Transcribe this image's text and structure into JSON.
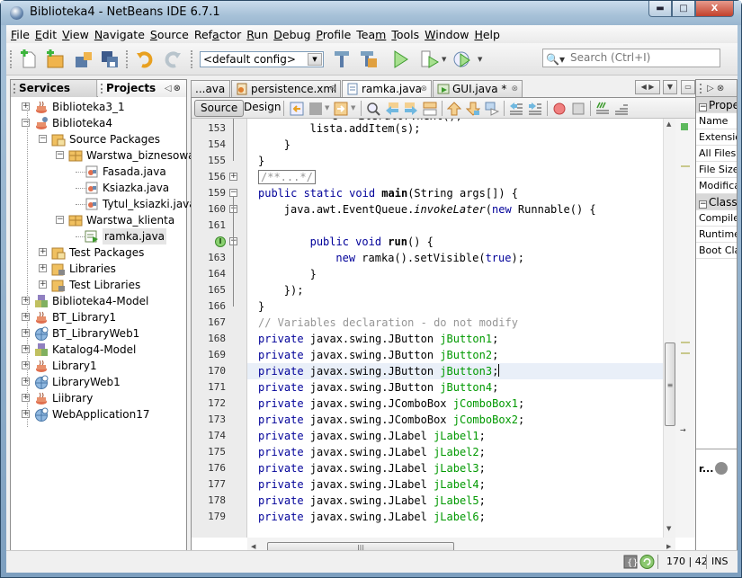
{
  "window": {
    "title": "Biblioteka4 - NetBeans IDE 6.7.1",
    "controls": [
      "minimize",
      "maximize",
      "close"
    ]
  },
  "menubar": {
    "items": [
      {
        "label": "File",
        "mnemonic": "F"
      },
      {
        "label": "Edit",
        "mnemonic": "E"
      },
      {
        "label": "View",
        "mnemonic": "V"
      },
      {
        "label": "Navigate",
        "mnemonic": "N"
      },
      {
        "label": "Source",
        "mnemonic": "S"
      },
      {
        "label": "Refactor",
        "mnemonic": "a"
      },
      {
        "label": "Run",
        "mnemonic": "R"
      },
      {
        "label": "Debug",
        "mnemonic": "D"
      },
      {
        "label": "Profile",
        "mnemonic": "P"
      },
      {
        "label": "Team",
        "mnemonic": "m"
      },
      {
        "label": "Tools",
        "mnemonic": "T"
      },
      {
        "label": "Window",
        "mnemonic": "W"
      },
      {
        "label": "Help",
        "mnemonic": "H"
      }
    ]
  },
  "toolbar": {
    "buttons": [
      "new-file",
      "new-project",
      "open-project",
      "save-all",
      "undo",
      "redo",
      "build",
      "clean-build",
      "run",
      "debug",
      "profile"
    ],
    "config_value": "<default config>",
    "search_placeholder": "Search (Ctrl+I)"
  },
  "left_pane": {
    "tabs": [
      {
        "label": "Services",
        "active": false
      },
      {
        "label": "Projects",
        "active": true
      }
    ],
    "tree": [
      {
        "label": "Biblioteka3_1",
        "level": 0,
        "expander": "+",
        "icon": "java-project-icon"
      },
      {
        "label": "Biblioteka4",
        "level": 0,
        "expander": "-",
        "icon": "java-project-main-icon"
      },
      {
        "label": "Source Packages",
        "level": 1,
        "expander": "-",
        "icon": "source-packages-icon"
      },
      {
        "label": "Warstwa_biznesowa",
        "level": 2,
        "expander": "-",
        "icon": "package-icon"
      },
      {
        "label": "Fasada.java",
        "level": 3,
        "expander": "",
        "icon": "java-class-icon"
      },
      {
        "label": "Ksiazka.java",
        "level": 3,
        "expander": "",
        "icon": "java-class-icon"
      },
      {
        "label": "Tytul_ksiazki.java",
        "level": 3,
        "expander": "",
        "icon": "java-class-icon"
      },
      {
        "label": "Warstwa_klienta",
        "level": 2,
        "expander": "-",
        "icon": "package-icon"
      },
      {
        "label": "ramka.java",
        "level": 3,
        "expander": "",
        "icon": "jframe-form-icon",
        "selected": true
      },
      {
        "label": "Test Packages",
        "level": 1,
        "expander": "+",
        "icon": "test-packages-icon"
      },
      {
        "label": "Libraries",
        "level": 1,
        "expander": "+",
        "icon": "libraries-icon"
      },
      {
        "label": "Test Libraries",
        "level": 1,
        "expander": "+",
        "icon": "libraries-icon"
      },
      {
        "label": "Biblioteka4-Model",
        "level": 0,
        "expander": "+",
        "icon": "ejb-module-icon"
      },
      {
        "label": "BT_Library1",
        "level": 0,
        "expander": "+",
        "icon": "java-project-icon"
      },
      {
        "label": "BT_LibraryWeb1",
        "level": 0,
        "expander": "+",
        "icon": "web-project-icon"
      },
      {
        "label": "Katalog4-Model",
        "level": 0,
        "expander": "+",
        "icon": "ejb-module-icon"
      },
      {
        "label": "Library1",
        "level": 0,
        "expander": "+",
        "icon": "java-project-icon"
      },
      {
        "label": "LibraryWeb1",
        "level": 0,
        "expander": "+",
        "icon": "web-project-icon"
      },
      {
        "label": "Liibrary",
        "level": 0,
        "expander": "+",
        "icon": "java-project-icon"
      },
      {
        "label": "WebApplication17",
        "level": 0,
        "expander": "+",
        "icon": "web-project-icon"
      }
    ]
  },
  "editor": {
    "tabs": [
      {
        "label": "...ava",
        "active": false,
        "closable": false
      },
      {
        "label": "persistence.xml",
        "active": false,
        "closable": true,
        "icon": "xml-file-icon"
      },
      {
        "label": "ramka.java",
        "active": true,
        "closable": true,
        "icon": "java-file-icon"
      },
      {
        "label": "GUI.java *",
        "active": false,
        "closable": true,
        "icon": "form-file-icon"
      }
    ],
    "view_buttons": {
      "source": "Source",
      "design": "Design"
    },
    "lines": [
      {
        "num": "153",
        "indent": 12,
        "tokens": [
          [
            "",
            "lista.addItem(s);"
          ]
        ]
      },
      {
        "num": "154",
        "indent": 8,
        "tokens": [
          [
            "",
            "}"
          ]
        ]
      },
      {
        "num": "155",
        "indent": 4,
        "tokens": [
          [
            "",
            "}"
          ]
        ]
      },
      {
        "num": "156",
        "indent": 4,
        "tokens": [
          [
            "collapsed",
            "/**...*/"
          ]
        ],
        "fold": "+"
      },
      {
        "num": "159",
        "indent": 4,
        "tokens": [
          [
            "kw",
            "public static void "
          ],
          [
            "fn",
            "main"
          ],
          [
            "",
            "(String args[]) {"
          ]
        ],
        "fold": "-"
      },
      {
        "num": "160",
        "indent": 8,
        "tokens": [
          [
            "",
            "java.awt.EventQueue."
          ],
          [
            "it",
            "invokeLater"
          ],
          [
            "",
            "("
          ],
          [
            "kw",
            "new"
          ],
          [
            "",
            " Runnable() {"
          ]
        ],
        "fold": "-"
      },
      {
        "num": "161",
        "indent": 0,
        "tokens": []
      },
      {
        "num": "",
        "indent": 12,
        "tokens": [
          [
            "kw",
            "public void "
          ],
          [
            "fn",
            "run"
          ],
          [
            "",
            "() {"
          ]
        ],
        "fold": "-",
        "annotation": "implements-icon"
      },
      {
        "num": "163",
        "indent": 16,
        "tokens": [
          [
            "kw",
            "new"
          ],
          [
            "",
            " ramka().setVisible("
          ],
          [
            "kw",
            "true"
          ],
          [
            "",
            ");"
          ]
        ]
      },
      {
        "num": "164",
        "indent": 12,
        "tokens": [
          [
            "",
            "}"
          ]
        ]
      },
      {
        "num": "165",
        "indent": 8,
        "tokens": [
          [
            "",
            "});"
          ]
        ]
      },
      {
        "num": "166",
        "indent": 4,
        "tokens": [
          [
            "",
            "}"
          ]
        ]
      },
      {
        "num": "167",
        "indent": 4,
        "tokens": [
          [
            "cm",
            "// Variables declaration - do not modify"
          ]
        ]
      },
      {
        "num": "168",
        "indent": 4,
        "tokens": [
          [
            "kw",
            "private"
          ],
          [
            "",
            " javax.swing.JButton "
          ],
          [
            "var",
            "jButton1"
          ],
          [
            "",
            ";"
          ]
        ]
      },
      {
        "num": "169",
        "indent": 4,
        "tokens": [
          [
            "kw",
            "private"
          ],
          [
            "",
            " javax.swing.JButton "
          ],
          [
            "var",
            "jButton2"
          ],
          [
            "",
            ";"
          ]
        ]
      },
      {
        "num": "170",
        "indent": 4,
        "tokens": [
          [
            "kw",
            "private"
          ],
          [
            "",
            " javax.swing.JButton "
          ],
          [
            "var",
            "jButton3"
          ],
          [
            "",
            ";"
          ]
        ],
        "current": true
      },
      {
        "num": "171",
        "indent": 4,
        "tokens": [
          [
            "kw",
            "private"
          ],
          [
            "",
            " javax.swing.JButton "
          ],
          [
            "var",
            "jButton4"
          ],
          [
            "",
            ";"
          ]
        ]
      },
      {
        "num": "172",
        "indent": 4,
        "tokens": [
          [
            "kw",
            "private"
          ],
          [
            "",
            " javax.swing.JComboBox "
          ],
          [
            "var",
            "jComboBox1"
          ],
          [
            "",
            ";"
          ]
        ]
      },
      {
        "num": "173",
        "indent": 4,
        "tokens": [
          [
            "kw",
            "private"
          ],
          [
            "",
            " javax.swing.JComboBox "
          ],
          [
            "var",
            "jComboBox2"
          ],
          [
            "",
            ";"
          ]
        ]
      },
      {
        "num": "174",
        "indent": 4,
        "tokens": [
          [
            "kw",
            "private"
          ],
          [
            "",
            " javax.swing.JLabel "
          ],
          [
            "var",
            "jLabel1"
          ],
          [
            "",
            ";"
          ]
        ]
      },
      {
        "num": "175",
        "indent": 4,
        "tokens": [
          [
            "kw",
            "private"
          ],
          [
            "",
            " javax.swing.JLabel "
          ],
          [
            "var",
            "jLabel2"
          ],
          [
            "",
            ";"
          ]
        ]
      },
      {
        "num": "176",
        "indent": 4,
        "tokens": [
          [
            "kw",
            "private"
          ],
          [
            "",
            " javax.swing.JLabel "
          ],
          [
            "var",
            "jLabel3"
          ],
          [
            "",
            ";"
          ]
        ]
      },
      {
        "num": "177",
        "indent": 4,
        "tokens": [
          [
            "kw",
            "private"
          ],
          [
            "",
            " javax.swing.JLabel "
          ],
          [
            "var",
            "jLabel4"
          ],
          [
            "",
            ";"
          ]
        ]
      },
      {
        "num": "178",
        "indent": 4,
        "tokens": [
          [
            "kw",
            "private"
          ],
          [
            "",
            " javax.swing.JLabel "
          ],
          [
            "var",
            "jLabel5"
          ],
          [
            "",
            ";"
          ]
        ]
      },
      {
        "num": "179",
        "indent": 4,
        "tokens": [
          [
            "kw",
            "private"
          ],
          [
            "",
            " javax.swing.JLabel "
          ],
          [
            "var",
            "jLabel6"
          ],
          [
            "",
            ";"
          ]
        ]
      }
    ]
  },
  "right_pane": {
    "header": "▷ ⊗",
    "properties": [
      {
        "label": "Prope",
        "category": true
      },
      {
        "label": "Name"
      },
      {
        "label": "Extensio"
      },
      {
        "label": "All Files"
      },
      {
        "label": "File Size"
      },
      {
        "label": "Modifica"
      },
      {
        "label": "Classp",
        "category": true
      },
      {
        "label": "Compile"
      },
      {
        "label": "Runtime"
      },
      {
        "label": "Boot Cla"
      }
    ],
    "bottom_label": "r..."
  },
  "statusbar": {
    "position": "170 | 42",
    "mode": "INS"
  },
  "colors": {
    "keyword": "#000099",
    "field": "#009900",
    "comment": "#969696",
    "current_line": "#e9eff8"
  }
}
